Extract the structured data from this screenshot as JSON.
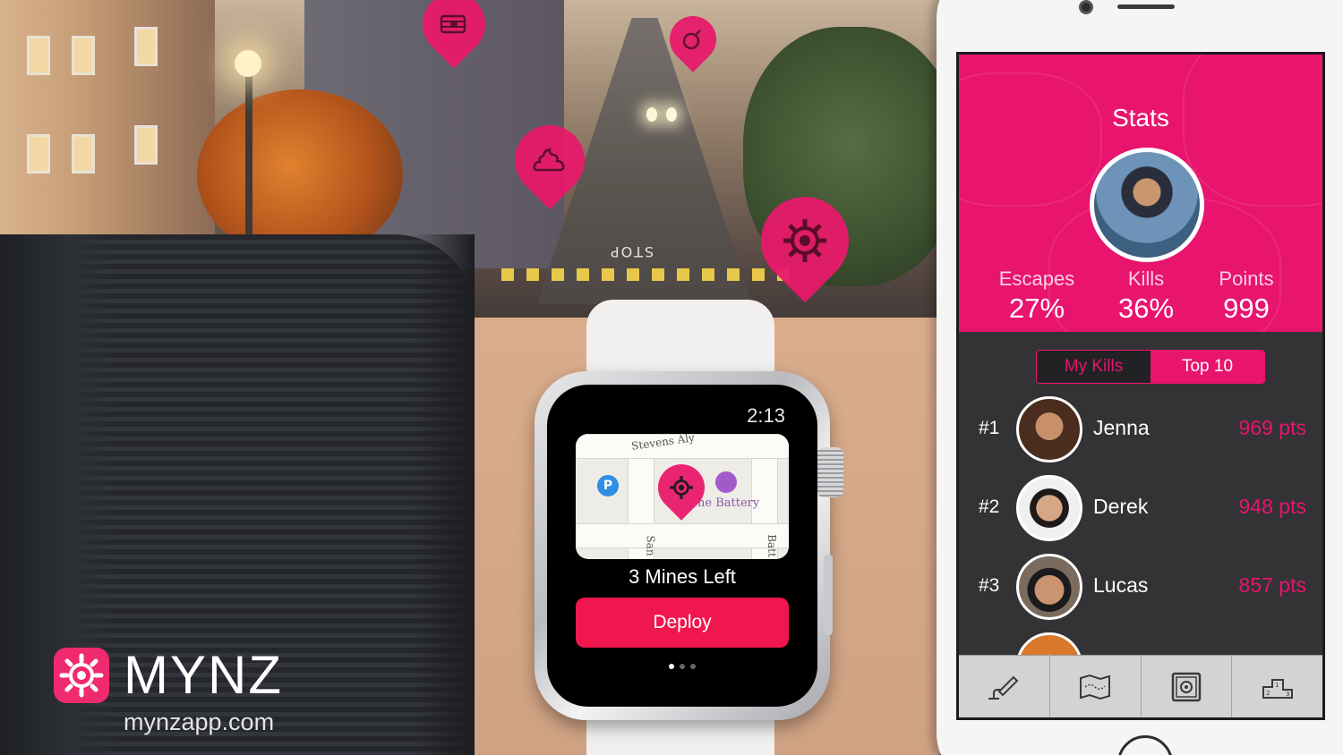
{
  "brand": {
    "name": "MYNZ",
    "url": "mynzapp.com",
    "accent": "#e8146e"
  },
  "scene": {
    "street_marking": "STOP",
    "map_pins": [
      "bomb-icon",
      "cherry-bomb-icon",
      "poop-icon",
      "mine-icon"
    ]
  },
  "watch": {
    "time": "2:13",
    "map_labels": {
      "street_top": "Stevens Aly",
      "street_bottom_left": "San",
      "street_bottom_right": "Batt",
      "place": "he Battery"
    },
    "mines_left": "3 Mines Left",
    "deploy_label": "Deploy",
    "page_dots": 3,
    "active_page": 1,
    "deploy_color": "#f0164e"
  },
  "phone": {
    "stats_title": "Stats",
    "stats": [
      {
        "label": "Escapes",
        "value": "27%"
      },
      {
        "label": "Kills",
        "value": "36%"
      },
      {
        "label": "Points",
        "value": "999"
      }
    ],
    "segments": [
      {
        "label": "My Kills",
        "active": false
      },
      {
        "label": "Top 10",
        "active": true
      }
    ],
    "leaderboard": [
      {
        "rank": "#1",
        "name": "Jenna",
        "points": "969 pts"
      },
      {
        "rank": "#2",
        "name": "Derek",
        "points": "948 pts"
      },
      {
        "rank": "#3",
        "name": "Lucas",
        "points": "857 pts"
      }
    ],
    "tabs": [
      "place-mine-icon",
      "map-icon",
      "safe-icon",
      "podium-icon"
    ]
  }
}
